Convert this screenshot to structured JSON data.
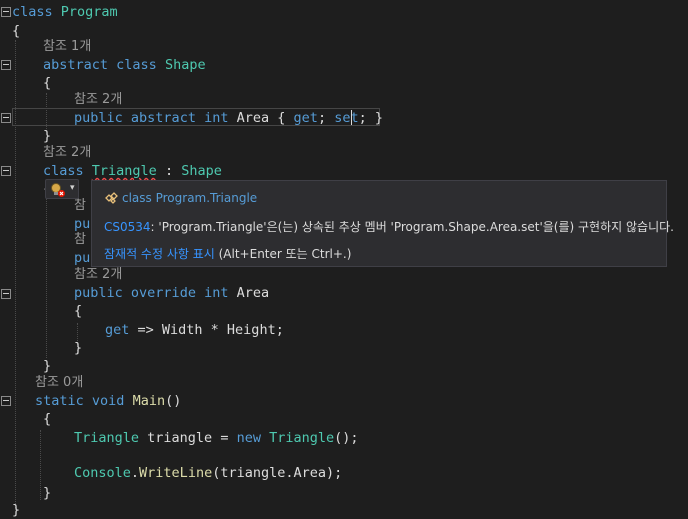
{
  "code": {
    "line_class_program": {
      "kw": "class",
      "name": "Program"
    },
    "brace_open": "{",
    "ref_1": "참조 1개",
    "shape_decl": {
      "kw1": "abstract",
      "kw2": "class",
      "name": "Shape"
    },
    "shape_brace_open": "{",
    "ref_2a": "참조 2개",
    "area_decl": {
      "kw1": "public",
      "kw2": "abstract",
      "kw3": "int",
      "name": "Area",
      "open": " {",
      "get": "get",
      "semi1": ";",
      "set": "set",
      "semi2": ";",
      "close": " }"
    },
    "shape_brace_close": "}",
    "ref_2b": "참조 2개",
    "triangle_decl": {
      "kw": "class",
      "name": "Triangle",
      "colon": " : ",
      "base": "Shape"
    },
    "tri_brace_open": "{",
    "hidden_ref": "참",
    "hidden_pub1": "pu",
    "hidden_ref2": "참",
    "hidden_pub2": "pu",
    "ref_2c": "참조 2개",
    "override_decl": {
      "kw1": "public",
      "kw2": "override",
      "kw3": "int",
      "name": "Area"
    },
    "override_brace_open": "{",
    "getter": {
      "kw": "get",
      "arrow": " => ",
      "expr": "Width * Height;"
    },
    "override_brace_close": "}",
    "tri_brace_close": "}",
    "ref_0": "참조 0개",
    "main_decl": {
      "kw1": "static",
      "kw2": "void",
      "name": "Main",
      "parens": "()"
    },
    "main_brace_open": "{",
    "new_line": {
      "type": "Triangle",
      "var": " triangle",
      "eq": " = ",
      "kw": "new",
      "ctor": "Triangle",
      "tail": "();"
    },
    "console_line": {
      "type": "Console",
      "dot": ".",
      "method": "WriteLine",
      "open": "(",
      "arg": "triangle.Area",
      "close": ");"
    },
    "main_brace_close": "}",
    "class_brace_close": "}"
  },
  "tooltip": {
    "header": "class Program.Triangle",
    "error_code": "CS0534",
    "error_text": ": 'Program.Triangle'은(는) 상속된 추상 멤버 'Program.Shape.Area.set'을(를) 구현하지 않습니다.",
    "link_text": "잠재적 수정 사항 표시",
    "link_hint": " (Alt+Enter 또는 Ctrl+.)"
  },
  "colors": {
    "background": "#1e1e1e",
    "keyword": "#569cd6",
    "type": "#4ec9b0",
    "method": "#dcdcaa",
    "error": "#f14c4c",
    "link": "#3794ff"
  },
  "icons": [
    "fold-collapse-icon",
    "lightbulb-error-icon",
    "class-icon"
  ]
}
